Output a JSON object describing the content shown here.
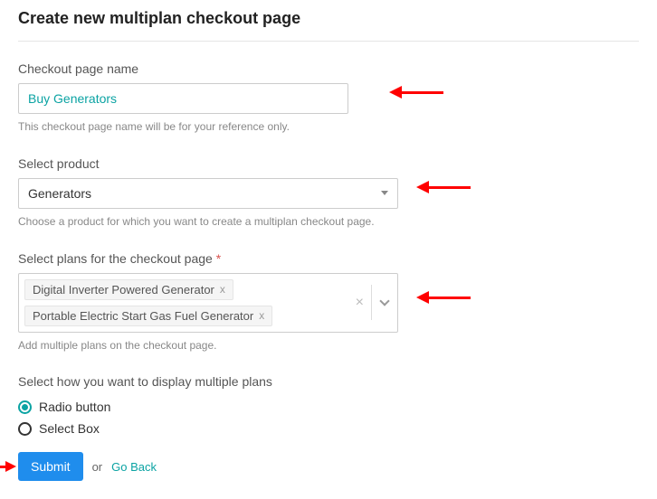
{
  "page_title": "Create new multiplan checkout page",
  "name_field": {
    "label": "Checkout page name",
    "value": "Buy Generators",
    "helper": "This checkout page name will be for your reference only."
  },
  "product_field": {
    "label": "Select product",
    "value": "Generators",
    "helper": "Choose a product for which you want to create a multiplan checkout page."
  },
  "plans_field": {
    "label": "Select plans for the checkout page",
    "required_mark": "*",
    "chips": [
      "Digital Inverter Powered Generator",
      "Portable Electric Start Gas Fuel Generator"
    ],
    "helper": "Add multiple plans on the checkout page."
  },
  "display_field": {
    "label": "Select how you want to display multiple plans",
    "options": [
      {
        "label": "Radio button",
        "checked": true
      },
      {
        "label": "Select Box",
        "checked": false
      }
    ]
  },
  "actions": {
    "submit": "Submit",
    "or": "or",
    "go_back": "Go Back"
  }
}
